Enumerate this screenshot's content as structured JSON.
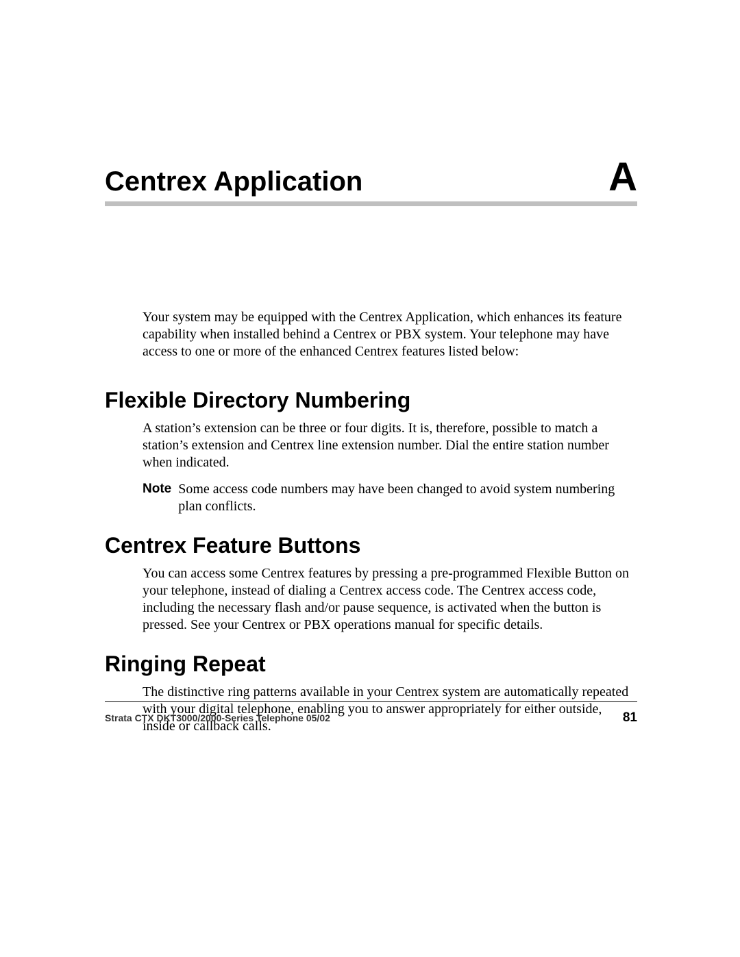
{
  "chapter": {
    "title": "Centrex Application",
    "letter": "A"
  },
  "intro": "Your system may be equipped with the Centrex Application, which enhances its feature capability when installed behind a Centrex or PBX system. Your telephone may have access to one or more of the enhanced Centrex features listed below:",
  "sections": [
    {
      "heading": "Flexible Directory Numbering",
      "body": "A station’s extension can be three or four digits. It is, therefore, possible to match a station’s extension and Centrex line extension number. Dial the entire station number when indicated.",
      "note_label": "Note",
      "note_text": "Some access code numbers may have been changed to avoid system numbering plan conflicts."
    },
    {
      "heading": "Centrex Feature Buttons",
      "body": "You can access some Centrex features by pressing a pre-programmed Flexible Button on your telephone, instead of dialing a Centrex access code. The Centrex access code, including the necessary flash and/or pause sequence, is activated when the button is pressed. See your Centrex or PBX operations manual for specific details."
    },
    {
      "heading": "Ringing Repeat",
      "body": "The distinctive ring patterns available in your Centrex system are automatically repeated with your digital telephone, enabling you to answer appropriately for either outside, inside or callback calls."
    }
  ],
  "footer": {
    "left": "Strata CTX DKT3000/2000-Series Telephone   05/02",
    "page": "81"
  }
}
